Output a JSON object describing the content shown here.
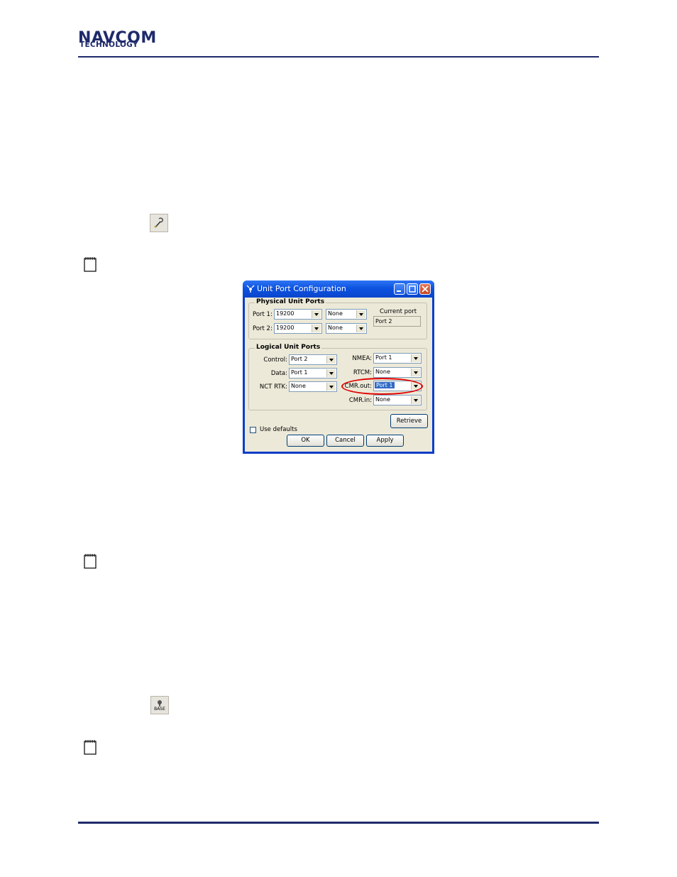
{
  "header": {
    "logo_main": "NAVCOM",
    "logo_sub": "TECHNOLOGY"
  },
  "toolbar_icons": {
    "base_label": "BASE"
  },
  "dialog": {
    "title": "Unit Port Configuration",
    "physical": {
      "label": "Physical  Unit Ports",
      "port1_label": "Port 1:",
      "port1_baud": "19200",
      "port1_mode": "None",
      "port2_label": "Port 2:",
      "port2_baud": "19200",
      "port2_mode": "None",
      "current_port_label": "Current port",
      "current_port_value": "Port 2"
    },
    "logical": {
      "label": "Logical Unit Ports",
      "control_label": "Control:",
      "control_value": "Port 2",
      "data_label": "Data:",
      "data_value": "Port 1",
      "nctrtk_label": "NCT RTK:",
      "nctrtk_value": "None",
      "nmea_label": "NMEA:",
      "nmea_value": "Port 1",
      "rtcm_label": "RTCM:",
      "rtcm_value": "None",
      "cmrout_label": "CMR.out:",
      "cmrout_value": "Port 1",
      "cmrin_label": "CMR.in:",
      "cmrin_value": "None"
    },
    "use_defaults_label": "Use defaults",
    "retrieve_label": "Retrieve",
    "ok_label": "OK",
    "cancel_label": "Cancel",
    "apply_label": "Apply"
  },
  "colors": {
    "accent": "#1f2a6b",
    "highlight": "#e00000",
    "titlebar": "#0d53e0"
  }
}
